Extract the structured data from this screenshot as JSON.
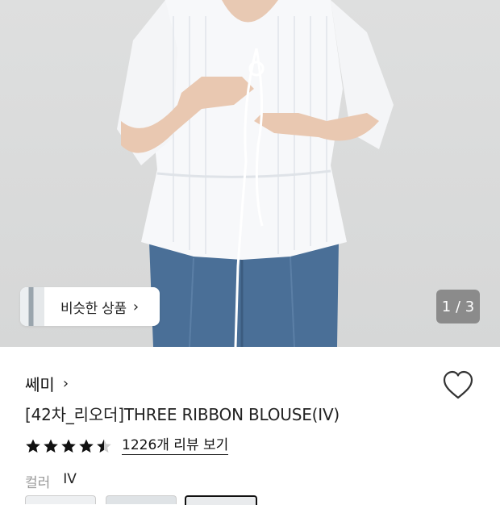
{
  "hero": {
    "similar_button_label": "비슷한 상품",
    "similar_chevron": "›",
    "counter": "1 / 3"
  },
  "product": {
    "brand": "쎄미",
    "brand_chevron": "›",
    "title": "[42차_리오더]THREE RIBBON BLOUSE(IV)",
    "rating": 4.5,
    "review_link": "1226개 리뷰 보기",
    "option_label": "컬러",
    "option_value": "IV"
  },
  "colors": {
    "star": "#111111",
    "star_empty": "#cccccc"
  }
}
